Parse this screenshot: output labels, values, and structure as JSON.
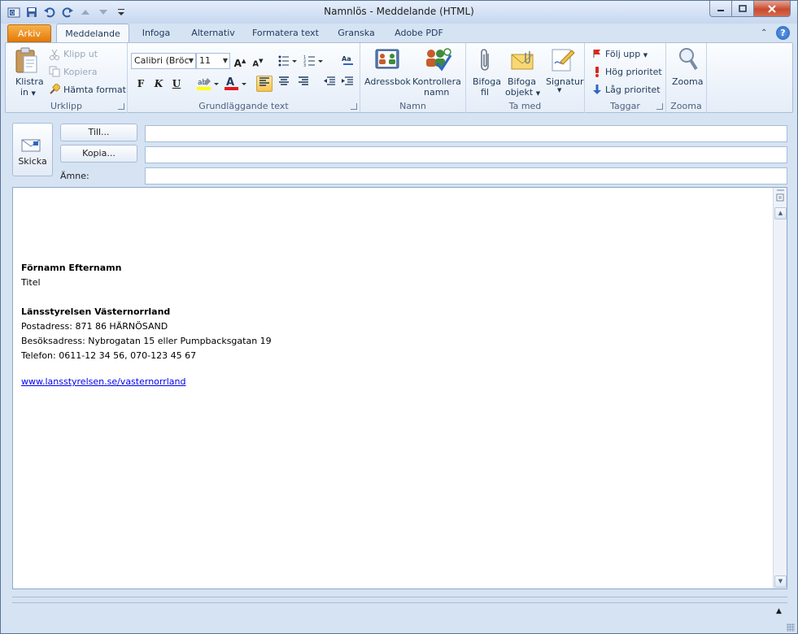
{
  "window": {
    "title": "Namnlös  -  Meddelande (HTML)"
  },
  "tabs": [
    {
      "label": "Arkiv"
    },
    {
      "label": "Meddelande"
    },
    {
      "label": "Infoga"
    },
    {
      "label": "Alternativ"
    },
    {
      "label": "Formatera text"
    },
    {
      "label": "Granska"
    },
    {
      "label": "Adobe PDF"
    }
  ],
  "ribbon": {
    "urklipp": {
      "label": "Urklipp",
      "paste_l1": "Klistra",
      "paste_l2": "in",
      "cut": "Klipp ut",
      "copy": "Kopiera",
      "format_painter": "Hämta format"
    },
    "text": {
      "label": "Grundläggande text",
      "font": "Calibri (Bröc",
      "size": "11"
    },
    "namn": {
      "label": "Namn",
      "addressbook": "Adressbok",
      "check_l1": "Kontrollera",
      "check_l2": "namn"
    },
    "include": {
      "label": "Ta med",
      "attach_l1": "Bifoga",
      "attach_l2": "fil",
      "attach_item_l1": "Bifoga",
      "attach_item_l2": "objekt",
      "signature": "Signatur"
    },
    "tags": {
      "label": "Taggar",
      "follow": "Följ upp",
      "high": "Hög prioritet",
      "low": "Låg prioritet"
    },
    "zoom": {
      "label": "Zooma",
      "button": "Zooma"
    }
  },
  "header": {
    "send": "Skicka",
    "to_button": "Till...",
    "cc_button": "Kopia...",
    "subject_label": "Ämne:",
    "to_value": "",
    "cc_value": "",
    "subject_value": ""
  },
  "signature": {
    "name": "Förnamn Efternamn",
    "title": "Titel",
    "org": "Länsstyrelsen Västernorrland",
    "postal": "Postadress: 871 86 HÄRNÖSAND",
    "visit": "Besöksadress: Nybrogatan 15 eller Pumpbacksgatan 19",
    "phone": "Telefon: 0611-12 34 56, 070-123 45 67",
    "url": "www.lansstyrelsen.se/vasternorrland"
  }
}
